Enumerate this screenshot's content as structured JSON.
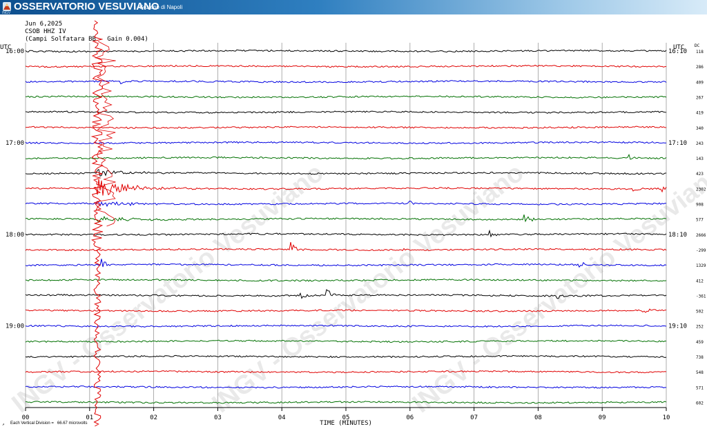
{
  "header": {
    "brand": "OSSERVATORIO VESUVIANO",
    "subtitle": "Sezione di Napoli",
    "logo_caption": "INGV",
    "logo_icon": "ingv-logo-icon",
    "colors": {
      "banner_start": "#0d4f8e",
      "banner_end": "#d8ebf8"
    }
  },
  "station": {
    "date": "Jun 6,2025",
    "code": "CSOB HHZ IV",
    "description": "(Campi Solfatara BB - Gain 0.004)"
  },
  "watermark": "INGV - Osservatorio Vesuviano",
  "footnote": {
    "mark": "↗",
    "text": "Each Vertical Division =   66.67 microvolts"
  },
  "chart_data": {
    "type": "line",
    "title": "",
    "xlabel": "TIME (MINUTES)",
    "ylabel": "",
    "xlim": [
      0,
      10
    ],
    "x_ticks": [
      "00",
      "01",
      "02",
      "03",
      "04",
      "05",
      "06",
      "07",
      "08",
      "09",
      "10"
    ],
    "left_axis_label": "UTC",
    "right_axis_label": "UTC",
    "dc_label": "DC",
    "left_time_labels": [
      {
        "row": 0,
        "label": "16:00"
      },
      {
        "row": 6,
        "label": "17:00"
      },
      {
        "row": 12,
        "label": "18:00"
      },
      {
        "row": 18,
        "label": "19:00"
      }
    ],
    "right_time_labels": [
      {
        "row": 0,
        "label": "16:10"
      },
      {
        "row": 6,
        "label": "17:10"
      },
      {
        "row": 12,
        "label": "18:10"
      },
      {
        "row": 18,
        "label": "19:10"
      }
    ],
    "grid": true,
    "line_colors": [
      "#000000",
      "#e00000",
      "#0000e0",
      "#007000"
    ],
    "series": [
      {
        "dc": "118",
        "events": []
      },
      {
        "dc": "286",
        "events": []
      },
      {
        "dc": "409",
        "events": [
          {
            "t": 1.5,
            "amp": 4
          }
        ]
      },
      {
        "dc": "267",
        "events": []
      },
      {
        "dc": "419",
        "events": []
      },
      {
        "dc": "340",
        "events": []
      },
      {
        "dc": "243",
        "events": []
      },
      {
        "dc": "143",
        "events": [
          {
            "t": 9.4,
            "amp": 9
          }
        ]
      },
      {
        "dc": "423",
        "events": []
      },
      {
        "dc": "2302",
        "events": [
          {
            "t": 9.5,
            "amp": 5
          },
          {
            "t": 9.95,
            "amp": 6
          }
        ]
      },
      {
        "dc": "908",
        "events": [
          {
            "t": 6.0,
            "amp": 6
          }
        ]
      },
      {
        "dc": "577",
        "events": [
          {
            "t": 7.78,
            "amp": 24
          }
        ]
      },
      {
        "dc": "2666",
        "events": [
          {
            "t": 7.25,
            "amp": 5
          }
        ]
      },
      {
        "dc": "-299",
        "events": [
          {
            "t": 4.15,
            "amp": 14
          },
          {
            "t": 5.9,
            "amp": 4
          }
        ]
      },
      {
        "dc": "1329",
        "events": [
          {
            "t": 1.2,
            "amp": 8
          },
          {
            "t": 8.65,
            "amp": 8
          }
        ]
      },
      {
        "dc": "412",
        "events": []
      },
      {
        "dc": "-361",
        "events": [
          {
            "t": 4.3,
            "amp": 6
          },
          {
            "t": 4.7,
            "amp": 16
          },
          {
            "t": 8.3,
            "amp": 5
          }
        ]
      },
      {
        "dc": "502",
        "events": [
          {
            "t": 9.65,
            "amp": 6
          }
        ]
      },
      {
        "dc": "252",
        "events": []
      },
      {
        "dc": "459",
        "events": []
      },
      {
        "dc": "738",
        "events": []
      },
      {
        "dc": "548",
        "events": []
      },
      {
        "dc": "571",
        "events": []
      },
      {
        "dc": "602",
        "events": []
      }
    ],
    "earthquake": {
      "minute": 1.12,
      "start_row": 0,
      "coda_row": 9
    }
  }
}
